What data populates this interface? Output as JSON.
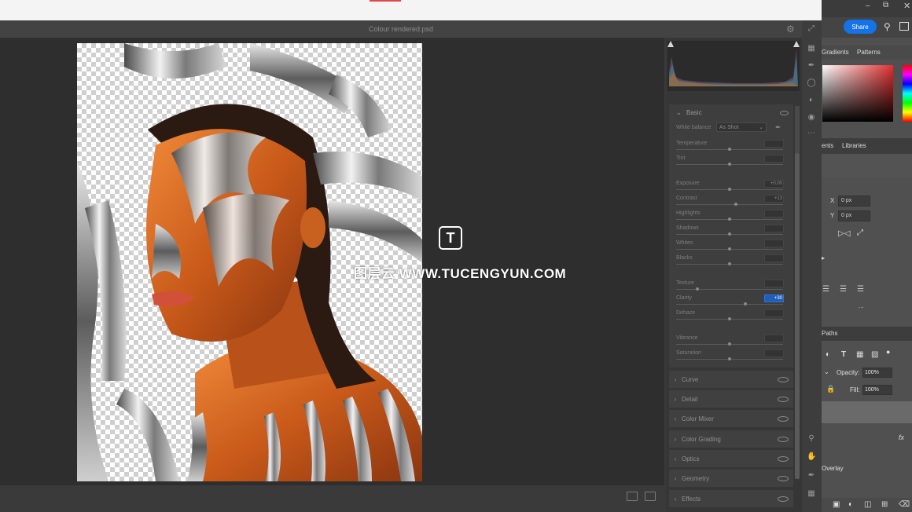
{
  "dialog": {
    "title": "Colour rendered.psd",
    "basic_panel": {
      "title": "Basic",
      "white_balance": {
        "label": "White balance",
        "value": "As Shot"
      },
      "sliders": [
        {
          "label": "Temperature",
          "value": "",
          "level": 0.5
        },
        {
          "label": "Tint",
          "value": "",
          "level": 0.5
        },
        {
          "label": "Exposure",
          "value": "+0.00",
          "level": 0.5
        },
        {
          "label": "Contrast",
          "value": "+13",
          "level": 0.56
        },
        {
          "label": "Highlights",
          "value": "",
          "level": 0.5
        },
        {
          "label": "Shadows",
          "value": "",
          "level": 0.5
        },
        {
          "label": "Whites",
          "value": "",
          "level": 0.5
        },
        {
          "label": "Blacks",
          "value": "",
          "level": 0.5
        },
        {
          "label": "Texture",
          "value": "",
          "level": 0.2
        },
        {
          "label": "Clarity",
          "value": "+30",
          "level": 0.65,
          "highlight": true
        },
        {
          "label": "Dehaze",
          "value": "",
          "level": 0.5
        },
        {
          "label": "Vibrance",
          "value": "",
          "level": 0.5
        },
        {
          "label": "Saturation",
          "value": "",
          "level": 0.5
        }
      ]
    },
    "sections": [
      "Curve",
      "Detail",
      "Color Mixer",
      "Color Grading",
      "Optics",
      "Geometry",
      "Effects"
    ]
  },
  "photoshop": {
    "share_label": "Share",
    "swatch_tabs": [
      "Gradients",
      "Patterns"
    ],
    "props_tabs": [
      "ents",
      "Libraries"
    ],
    "x_label": "X",
    "x_value": "0 px",
    "y_label": "Y",
    "y_value": "0 px",
    "layers_tab": "Paths",
    "opacity_label": "Opacity:",
    "opacity_value": "100%",
    "fill_label": "Fill:",
    "fill_value": "100%",
    "effect_label": "Overlay",
    "fx_label": "fx",
    "ellipsis": "..."
  },
  "watermark": {
    "text": "图层云 WWW.TUCENGYUN.COM",
    "logo": "T"
  },
  "colors": {
    "accent": "#1473e6",
    "panel": "#3a3a3a",
    "canvas": "#2e2e2e"
  }
}
